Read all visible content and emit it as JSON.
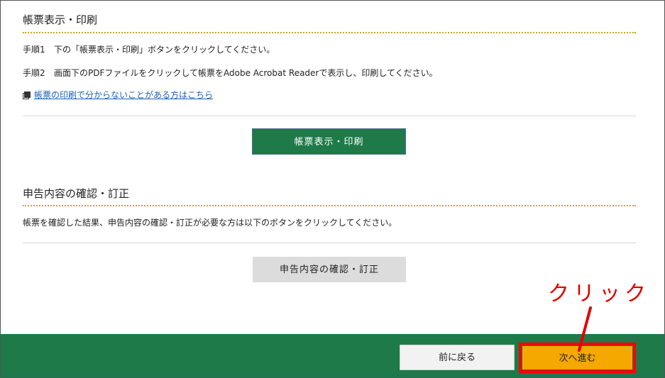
{
  "print_section": {
    "title": "帳票表示・印刷",
    "step1_num": "手順1",
    "step1_text": "下の「帳票表示・印刷」ボタンをクリックしてください。",
    "step2_num": "手順2",
    "step2_text": "画面下のPDFファイルをクリックして帳票をAdobe Acrobat Readerで表示し、印刷してください。",
    "help_link": "帳票の印刷で分からないことがある方はこちら",
    "print_button": "帳票表示・印刷"
  },
  "confirm_section": {
    "title": "申告内容の確認・訂正",
    "description": "帳票を確認した結果、申告内容の確認・訂正が必要な方は以下のボタンをクリックしてください。",
    "correct_button": "申告内容の確認・訂正"
  },
  "footer": {
    "back_button": "前に戻る",
    "next_button": "次へ進む"
  },
  "annotation": {
    "text": "クリック"
  },
  "colors": {
    "primary_green": "#1e7a49",
    "dotted_gold": "#d4a21e",
    "next_orange": "#f5a800",
    "highlight_red": "#ff0000",
    "link_blue": "#1a5fb4"
  }
}
